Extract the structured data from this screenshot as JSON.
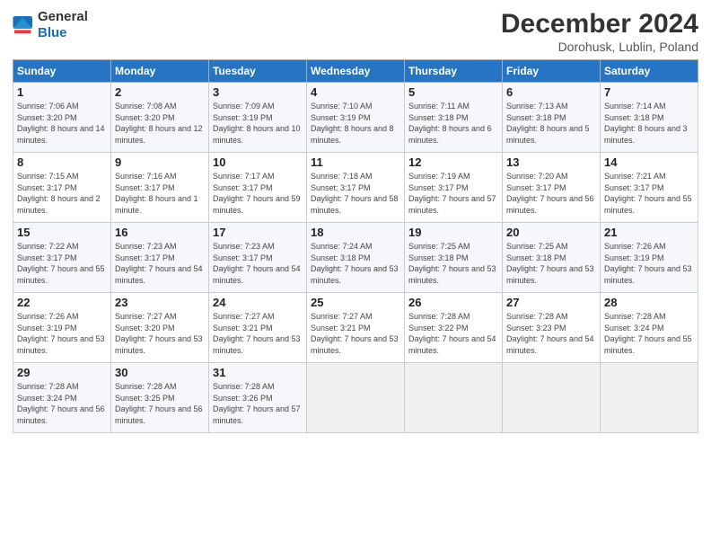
{
  "header": {
    "logo_general": "General",
    "logo_blue": "Blue",
    "month": "December 2024",
    "location": "Dorohusk, Lublin, Poland"
  },
  "weekdays": [
    "Sunday",
    "Monday",
    "Tuesday",
    "Wednesday",
    "Thursday",
    "Friday",
    "Saturday"
  ],
  "weeks": [
    [
      {
        "day": "1",
        "sunrise": "Sunrise: 7:06 AM",
        "sunset": "Sunset: 3:20 PM",
        "daylight": "Daylight: 8 hours and 14 minutes."
      },
      {
        "day": "2",
        "sunrise": "Sunrise: 7:08 AM",
        "sunset": "Sunset: 3:20 PM",
        "daylight": "Daylight: 8 hours and 12 minutes."
      },
      {
        "day": "3",
        "sunrise": "Sunrise: 7:09 AM",
        "sunset": "Sunset: 3:19 PM",
        "daylight": "Daylight: 8 hours and 10 minutes."
      },
      {
        "day": "4",
        "sunrise": "Sunrise: 7:10 AM",
        "sunset": "Sunset: 3:19 PM",
        "daylight": "Daylight: 8 hours and 8 minutes."
      },
      {
        "day": "5",
        "sunrise": "Sunrise: 7:11 AM",
        "sunset": "Sunset: 3:18 PM",
        "daylight": "Daylight: 8 hours and 6 minutes."
      },
      {
        "day": "6",
        "sunrise": "Sunrise: 7:13 AM",
        "sunset": "Sunset: 3:18 PM",
        "daylight": "Daylight: 8 hours and 5 minutes."
      },
      {
        "day": "7",
        "sunrise": "Sunrise: 7:14 AM",
        "sunset": "Sunset: 3:18 PM",
        "daylight": "Daylight: 8 hours and 3 minutes."
      }
    ],
    [
      {
        "day": "8",
        "sunrise": "Sunrise: 7:15 AM",
        "sunset": "Sunset: 3:17 PM",
        "daylight": "Daylight: 8 hours and 2 minutes."
      },
      {
        "day": "9",
        "sunrise": "Sunrise: 7:16 AM",
        "sunset": "Sunset: 3:17 PM",
        "daylight": "Daylight: 8 hours and 1 minute."
      },
      {
        "day": "10",
        "sunrise": "Sunrise: 7:17 AM",
        "sunset": "Sunset: 3:17 PM",
        "daylight": "Daylight: 7 hours and 59 minutes."
      },
      {
        "day": "11",
        "sunrise": "Sunrise: 7:18 AM",
        "sunset": "Sunset: 3:17 PM",
        "daylight": "Daylight: 7 hours and 58 minutes."
      },
      {
        "day": "12",
        "sunrise": "Sunrise: 7:19 AM",
        "sunset": "Sunset: 3:17 PM",
        "daylight": "Daylight: 7 hours and 57 minutes."
      },
      {
        "day": "13",
        "sunrise": "Sunrise: 7:20 AM",
        "sunset": "Sunset: 3:17 PM",
        "daylight": "Daylight: 7 hours and 56 minutes."
      },
      {
        "day": "14",
        "sunrise": "Sunrise: 7:21 AM",
        "sunset": "Sunset: 3:17 PM",
        "daylight": "Daylight: 7 hours and 55 minutes."
      }
    ],
    [
      {
        "day": "15",
        "sunrise": "Sunrise: 7:22 AM",
        "sunset": "Sunset: 3:17 PM",
        "daylight": "Daylight: 7 hours and 55 minutes."
      },
      {
        "day": "16",
        "sunrise": "Sunrise: 7:23 AM",
        "sunset": "Sunset: 3:17 PM",
        "daylight": "Daylight: 7 hours and 54 minutes."
      },
      {
        "day": "17",
        "sunrise": "Sunrise: 7:23 AM",
        "sunset": "Sunset: 3:17 PM",
        "daylight": "Daylight: 7 hours and 54 minutes."
      },
      {
        "day": "18",
        "sunrise": "Sunrise: 7:24 AM",
        "sunset": "Sunset: 3:18 PM",
        "daylight": "Daylight: 7 hours and 53 minutes."
      },
      {
        "day": "19",
        "sunrise": "Sunrise: 7:25 AM",
        "sunset": "Sunset: 3:18 PM",
        "daylight": "Daylight: 7 hours and 53 minutes."
      },
      {
        "day": "20",
        "sunrise": "Sunrise: 7:25 AM",
        "sunset": "Sunset: 3:18 PM",
        "daylight": "Daylight: 7 hours and 53 minutes."
      },
      {
        "day": "21",
        "sunrise": "Sunrise: 7:26 AM",
        "sunset": "Sunset: 3:19 PM",
        "daylight": "Daylight: 7 hours and 53 minutes."
      }
    ],
    [
      {
        "day": "22",
        "sunrise": "Sunrise: 7:26 AM",
        "sunset": "Sunset: 3:19 PM",
        "daylight": "Daylight: 7 hours and 53 minutes."
      },
      {
        "day": "23",
        "sunrise": "Sunrise: 7:27 AM",
        "sunset": "Sunset: 3:20 PM",
        "daylight": "Daylight: 7 hours and 53 minutes."
      },
      {
        "day": "24",
        "sunrise": "Sunrise: 7:27 AM",
        "sunset": "Sunset: 3:21 PM",
        "daylight": "Daylight: 7 hours and 53 minutes."
      },
      {
        "day": "25",
        "sunrise": "Sunrise: 7:27 AM",
        "sunset": "Sunset: 3:21 PM",
        "daylight": "Daylight: 7 hours and 53 minutes."
      },
      {
        "day": "26",
        "sunrise": "Sunrise: 7:28 AM",
        "sunset": "Sunset: 3:22 PM",
        "daylight": "Daylight: 7 hours and 54 minutes."
      },
      {
        "day": "27",
        "sunrise": "Sunrise: 7:28 AM",
        "sunset": "Sunset: 3:23 PM",
        "daylight": "Daylight: 7 hours and 54 minutes."
      },
      {
        "day": "28",
        "sunrise": "Sunrise: 7:28 AM",
        "sunset": "Sunset: 3:24 PM",
        "daylight": "Daylight: 7 hours and 55 minutes."
      }
    ],
    [
      {
        "day": "29",
        "sunrise": "Sunrise: 7:28 AM",
        "sunset": "Sunset: 3:24 PM",
        "daylight": "Daylight: 7 hours and 56 minutes."
      },
      {
        "day": "30",
        "sunrise": "Sunrise: 7:28 AM",
        "sunset": "Sunset: 3:25 PM",
        "daylight": "Daylight: 7 hours and 56 minutes."
      },
      {
        "day": "31",
        "sunrise": "Sunrise: 7:28 AM",
        "sunset": "Sunset: 3:26 PM",
        "daylight": "Daylight: 7 hours and 57 minutes."
      },
      null,
      null,
      null,
      null
    ]
  ]
}
